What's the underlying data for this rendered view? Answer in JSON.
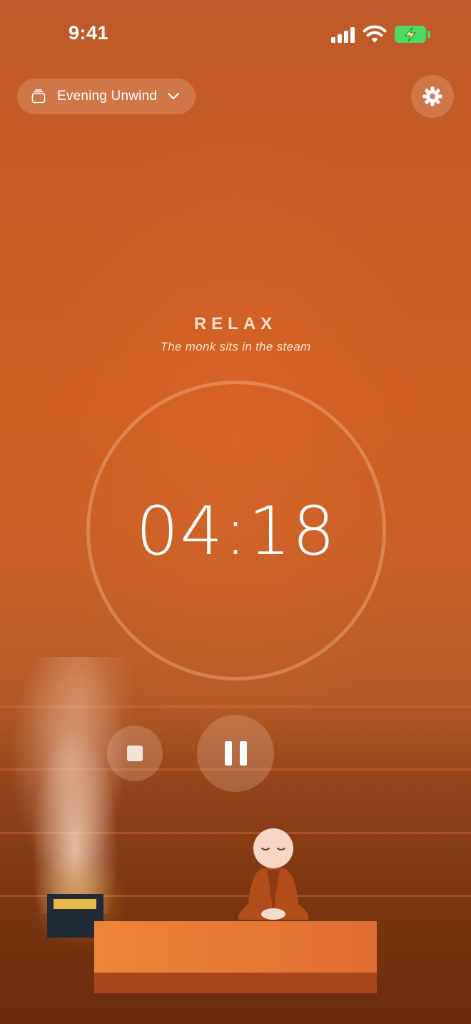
{
  "status_bar": {
    "time": "9:41"
  },
  "preset": {
    "label": "Evening Unwind"
  },
  "session": {
    "phase": "RELAX",
    "subtitle": "The monk sits in the steam",
    "timer": "04:18"
  },
  "controls": {
    "stop": "stop",
    "pause": "pause"
  },
  "icons": {
    "signal": "cellular-signal-icon",
    "wifi": "wifi-icon",
    "battery": "battery-charging-icon",
    "preset": "stack-icon",
    "dropdown": "chevron-down-icon",
    "settings": "gear-icon"
  },
  "colors": {
    "background": "#c95b25",
    "accent": "#ffffff",
    "battery": "#4cd964",
    "bench": "#e8783a",
    "heater": "#1f2b37",
    "heater_coals": "#e7b84a"
  }
}
